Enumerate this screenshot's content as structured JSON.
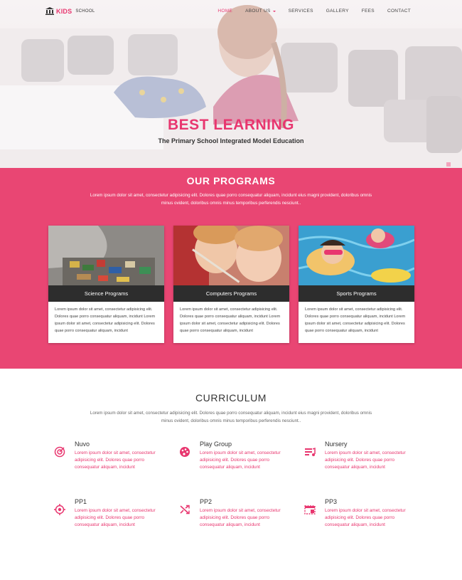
{
  "logo": {
    "brand": "KIDS",
    "suffix": "SCHOOL"
  },
  "nav": {
    "items": [
      "HOME",
      "ABOUT US",
      "SERVICES",
      "GALLERY",
      "FEES",
      "CONTACT"
    ]
  },
  "hero": {
    "title": "BEST LEARNING",
    "subtitle": "The Primary School Integrated Model Education"
  },
  "programs": {
    "title": "OUR PROGRAMS",
    "text": "Lorem ipsum dolor sit amet, consectetur adipisicing elit. Dolores quae porro consequatur aliquam, incidunt eius magni provident, doloribus omnis minus ovident, doloribus omnis minus temporibus perferendis nesciunt..",
    "cards": [
      {
        "title": "Science Programs",
        "text": "Lorem ipsum dolor sit amet, consectetur adipisicing elit. Dolores quae porro consequatur aliquam, incidunt Lorem ipsum dolor sit amet, consectetur adipisicing elit. Dolores quae porro consequatur aliquam, incidunt"
      },
      {
        "title": "Computers Programs",
        "text": "Lorem ipsum dolor sit amet, consectetur adipisicing elit. Dolores quae porro consequatur aliquam, incidunt Lorem ipsum dolor sit amet, consectetur adipisicing elit. Dolores quae porro consequatur aliquam, incidunt"
      },
      {
        "title": "Sports Programs",
        "text": "Lorem ipsum dolor sit amet, consectetur adipisicing elit. Dolores quae porro consequatur aliquam, incidunt Lorem ipsum dolor sit amet, consectetur adipisicing elit. Dolores quae porro consequatur aliquam, incidunt"
      }
    ]
  },
  "curriculum": {
    "title": "CURRICULUM",
    "text": "Lorem ipsum dolor sit amet, consectetur adipisicing elit. Dolores quae porro consequatur aliquam, incidunt eius magni provident, doloribus omnis minus ovident, doloribus omnis minus temporibus perferendis nesciunt..",
    "items": [
      {
        "name": "Nuvo",
        "icon": "target-icon",
        "text": "Lorem ipsum dolor sit amet, consectetur adipisicing elit. Dolores quae porro consequatur aliquam, incidunt"
      },
      {
        "name": "Play Group",
        "icon": "palette-icon",
        "text": "Lorem ipsum dolor sit amet, consectetur adipisicing elit. Dolores quae porro consequatur aliquam, incidunt"
      },
      {
        "name": "Nursery",
        "icon": "playlist-icon",
        "text": "Lorem ipsum dolor sit amet, consectetur adipisicing elit. Dolores quae porro consequatur aliquam, incidunt"
      },
      {
        "name": "PP1",
        "icon": "crosshair-icon",
        "text": "Lorem ipsum dolor sit amet, consectetur adipisicing elit. Dolores quae porro consequatur aliquam, incidunt"
      },
      {
        "name": "PP2",
        "icon": "shuffle-icon",
        "text": "Lorem ipsum dolor sit amet, consectetur adipisicing elit. Dolores quae porro consequatur aliquam, incidunt"
      },
      {
        "name": "PP3",
        "icon": "window-icon",
        "text": "Lorem ipsum dolor sit amet, consectetur adipisicing elit. Dolores quae porro consequatur aliquam, incidunt"
      }
    ]
  },
  "colors": {
    "accent": "#e8366f",
    "section_bg": "#e94673",
    "card_band": "#2d2d2d"
  }
}
